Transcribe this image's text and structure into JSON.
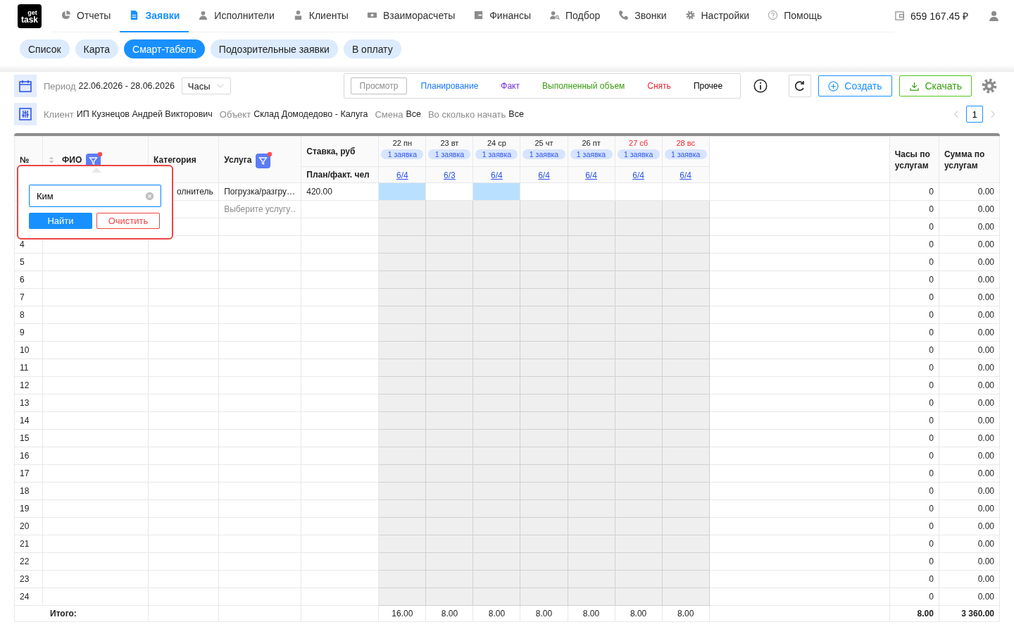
{
  "logo": {
    "top": "get",
    "bottom": "task"
  },
  "nav": [
    {
      "label": "Отчеты",
      "selected": false
    },
    {
      "label": "Заявки",
      "selected": true
    },
    {
      "label": "Исполнители",
      "selected": false
    },
    {
      "label": "Клиенты",
      "selected": false
    },
    {
      "label": "Взаиморасчеты",
      "selected": false
    },
    {
      "label": "Финансы",
      "selected": false
    },
    {
      "label": "Подбор",
      "selected": false
    },
    {
      "label": "Звонки",
      "selected": false
    },
    {
      "label": "Настройки",
      "selected": false
    },
    {
      "label": "Помощь",
      "selected": false
    }
  ],
  "balance": "659 167.45 ₽",
  "subtabs": [
    {
      "label": "Список",
      "selected": false
    },
    {
      "label": "Карта",
      "selected": false
    },
    {
      "label": "Смарт-табель",
      "selected": true
    },
    {
      "label": "Подозрительные заявки",
      "selected": false
    },
    {
      "label": "В оплату",
      "selected": false
    }
  ],
  "period": {
    "label": "Период",
    "value": "22.06.2026 - 28.06.2026"
  },
  "unit_select": {
    "value": "Часы"
  },
  "modes": [
    {
      "label": "Просмотр",
      "selected": true,
      "color": "#8c8c8c"
    },
    {
      "label": "Планирование",
      "selected": false,
      "color": "#1677ff"
    },
    {
      "label": "Факт",
      "selected": false,
      "color": "#722ed1"
    },
    {
      "label": "Выполненный объем",
      "selected": false,
      "color": "#389e0d"
    },
    {
      "label": "Снять",
      "selected": false,
      "color": "#f5222d"
    },
    {
      "label": "Прочее",
      "selected": false,
      "color": "#000000"
    }
  ],
  "actions": [
    {
      "label": "Создать",
      "kind": "create"
    },
    {
      "label": "Скачать",
      "kind": "download"
    }
  ],
  "filters": [
    {
      "label": "Клиент",
      "value": "ИП Кузнецов Андрей Викторович"
    },
    {
      "label": "Объект",
      "value": "Склад Домодедово - Калуга"
    },
    {
      "label": "Смена",
      "value": "Все"
    },
    {
      "label": "Во сколько начать",
      "value": "Все"
    }
  ],
  "pagination": {
    "page": "1"
  },
  "table": {
    "columns": [
      {
        "label": "№",
        "kind": "num"
      },
      {
        "label": "ФИО",
        "kind": "name",
        "sortable": true,
        "filter_active": true
      },
      {
        "label": "Категория",
        "kind": "text"
      },
      {
        "label": "Услуга",
        "kind": "text",
        "filter_active": true
      },
      {
        "label": "Ставка, руб",
        "sub": "План/факт. чел",
        "kind": "rate"
      }
    ],
    "days": [
      {
        "label": "22 пн",
        "weekend": false,
        "badge": "1 заявка",
        "plan": "6/4"
      },
      {
        "label": "23 вт",
        "weekend": false,
        "badge": "1 заявка",
        "plan": "6/3"
      },
      {
        "label": "24 ср",
        "weekend": false,
        "badge": "1 заявка",
        "plan": "6/4"
      },
      {
        "label": "25 чт",
        "weekend": false,
        "badge": "1 заявка",
        "plan": "6/4"
      },
      {
        "label": "26 пт",
        "weekend": false,
        "badge": "1 заявка",
        "plan": "6/4"
      },
      {
        "label": "27 сб",
        "weekend": true,
        "badge": "1 заявка",
        "plan": "6/4"
      },
      {
        "label": "28 вс",
        "weekend": true,
        "badge": "1 заявка",
        "plan": "6/4"
      }
    ],
    "totals_columns": [
      {
        "label": "Часы по услугам"
      },
      {
        "label": "Сумма по услугам"
      }
    ],
    "rows": [
      {
        "category": "олнитель",
        "service": "Погрузка/разгру…",
        "rate": "420.00",
        "days_disabled": false,
        "days": [
          {
            "highlighted": true
          },
          {
            "highlighted": false
          },
          {
            "highlighted": true
          },
          {
            "highlighted": false
          },
          {
            "highlighted": false
          },
          {
            "highlighted": false
          },
          {
            "highlighted": false
          }
        ],
        "hours": "0",
        "sum": "0.00"
      },
      {
        "service_field": {
          "placeholder": "Выберите услугу…"
        },
        "days_disabled": true,
        "hours": "0",
        "sum": "0.00"
      },
      {
        "days_disabled": true,
        "hours": "0",
        "sum": "0.00"
      },
      {
        "num": "4",
        "days_disabled": true,
        "hours": "0",
        "sum": "0.00"
      },
      {
        "num": "5",
        "days_disabled": true,
        "hours": "0",
        "sum": "0.00"
      },
      {
        "num": "6",
        "days_disabled": true,
        "hours": "0",
        "sum": "0.00"
      },
      {
        "num": "7",
        "days_disabled": true,
        "hours": "0",
        "sum": "0.00"
      },
      {
        "num": "8",
        "days_disabled": true,
        "hours": "0",
        "sum": "0.00"
      },
      {
        "num": "9",
        "days_disabled": true,
        "hours": "0",
        "sum": "0.00"
      },
      {
        "num": "10",
        "days_disabled": true,
        "hours": "0",
        "sum": "0.00"
      },
      {
        "num": "11",
        "days_disabled": true,
        "hours": "0",
        "sum": "0.00"
      },
      {
        "num": "12",
        "days_disabled": true,
        "hours": "0",
        "sum": "0.00"
      },
      {
        "num": "13",
        "days_disabled": true,
        "hours": "0",
        "sum": "0.00"
      },
      {
        "num": "14",
        "days_disabled": true,
        "hours": "0",
        "sum": "0.00"
      },
      {
        "num": "15",
        "days_disabled": true,
        "hours": "0",
        "sum": "0.00"
      },
      {
        "num": "16",
        "days_disabled": true,
        "hours": "0",
        "sum": "0.00"
      },
      {
        "num": "17",
        "days_disabled": true,
        "hours": "0",
        "sum": "0.00"
      },
      {
        "num": "18",
        "days_disabled": true,
        "hours": "0",
        "sum": "0.00"
      },
      {
        "num": "19",
        "days_disabled": true,
        "hours": "0",
        "sum": "0.00"
      },
      {
        "num": "20",
        "days_disabled": true,
        "hours": "0",
        "sum": "0.00"
      },
      {
        "num": "21",
        "days_disabled": true,
        "hours": "0",
        "sum": "0.00"
      },
      {
        "num": "22",
        "days_disabled": true,
        "hours": "0",
        "sum": "0.00"
      },
      {
        "num": "23",
        "days_disabled": true,
        "hours": "0",
        "sum": "0.00"
      },
      {
        "num": "24",
        "days_disabled": true,
        "hours": "0",
        "sum": "0.00"
      }
    ],
    "total": {
      "label": "Итого:",
      "days": [
        "16.00",
        "8.00",
        "8.00",
        "8.00",
        "8.00",
        "8.00",
        "8.00"
      ],
      "hours": "8.00",
      "sum": "3 360.00"
    }
  },
  "name_filter": {
    "value": "Ким",
    "search_button": "Найти",
    "clear_button": "Очистить"
  }
}
